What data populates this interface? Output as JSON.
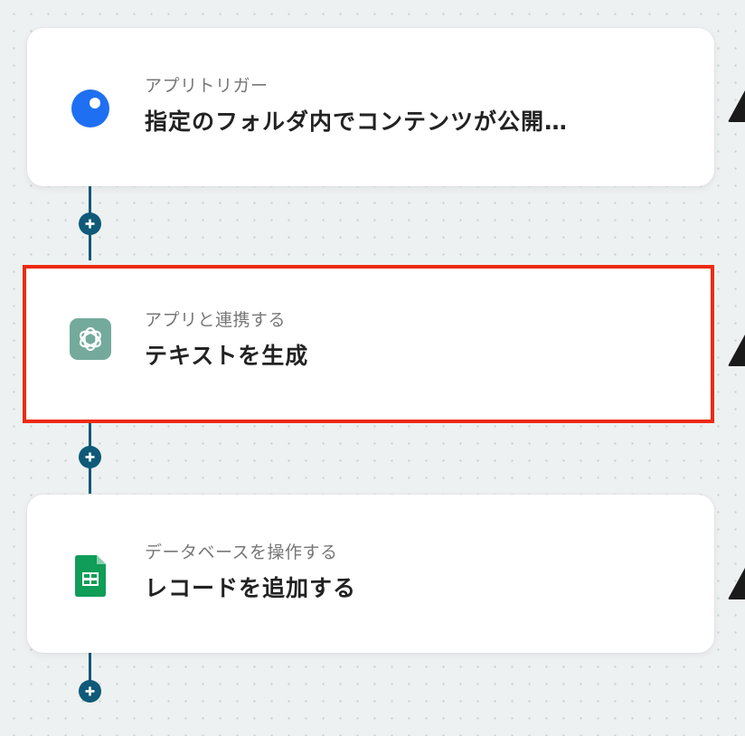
{
  "flow": {
    "steps": [
      {
        "label": "アプリトリガー",
        "title": "指定のフォルダ内でコンテンツが公開…",
        "icon": "blue-dot-app-icon",
        "color": "#1f6ff2"
      },
      {
        "label": "アプリと連携する",
        "title": "テキストを生成",
        "icon": "chatgpt-icon",
        "color": "#74aa9c"
      },
      {
        "label": "データベースを操作する",
        "title": "レコードを追加する",
        "icon": "google-sheets-icon",
        "color": "#0f9d58"
      }
    ]
  },
  "colors": {
    "connector": "#0e5a78",
    "highlight": "#ee2a12",
    "background": "#eef1f1"
  }
}
